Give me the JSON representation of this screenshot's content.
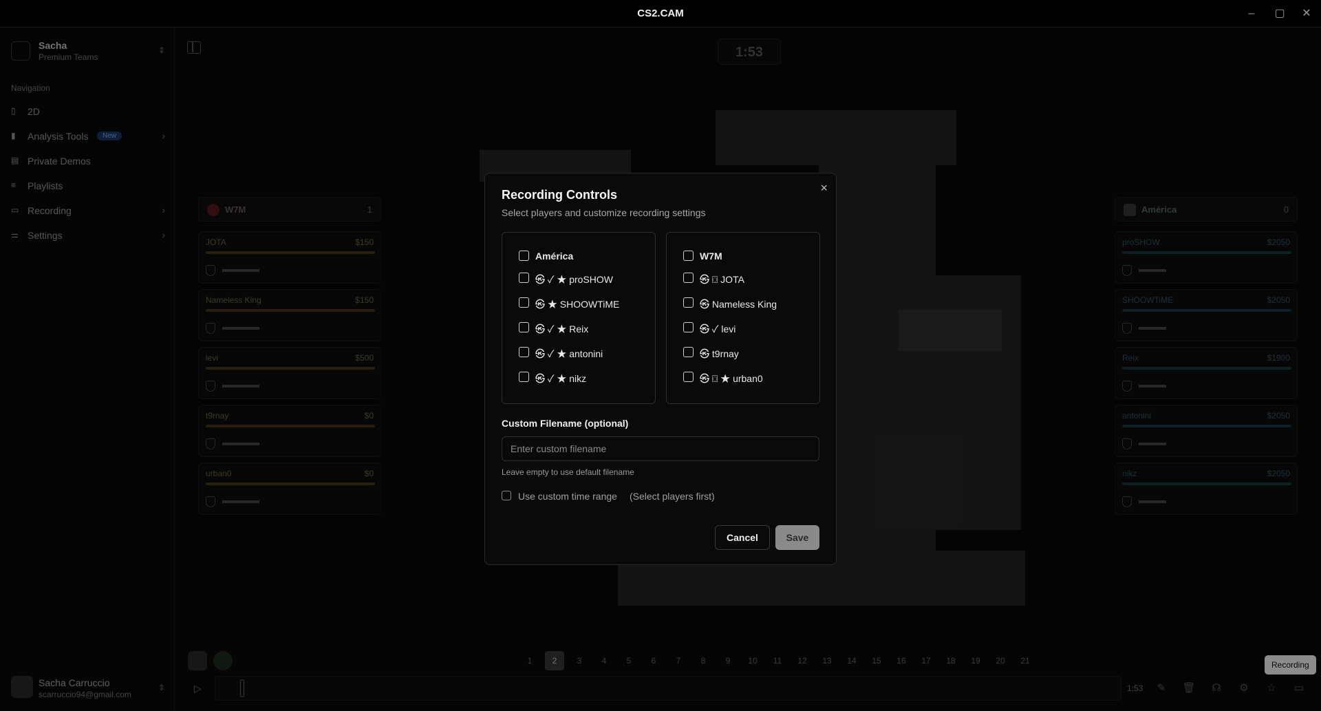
{
  "window": {
    "title": "CS2.CAM",
    "controls": [
      "minimize",
      "maximize",
      "close"
    ]
  },
  "sidebar": {
    "user": {
      "name": "Sacha",
      "plan": "Premium Teams"
    },
    "nav_heading": "Navigation",
    "items": [
      {
        "label": "2D",
        "icon": "map-icon"
      },
      {
        "label": "Analysis Tools",
        "icon": "bar-chart-icon",
        "badge": "New"
      },
      {
        "label": "Private Demos",
        "icon": "file-icon"
      },
      {
        "label": "Playlists",
        "icon": "list-icon"
      },
      {
        "label": "Recording",
        "icon": "video-icon"
      },
      {
        "label": "Settings",
        "icon": "sliders-icon"
      }
    ],
    "account": {
      "name": "Sacha Carruccio",
      "email": "scarruccio94@gmail.com"
    }
  },
  "match": {
    "timer": "1:53",
    "left_team": {
      "name": "W7M",
      "score": "1",
      "players": [
        {
          "name": "JOTA",
          "money": "$150"
        },
        {
          "name": "Nameless King",
          "money": "$150"
        },
        {
          "name": "levi",
          "money": "$500"
        },
        {
          "name": "t9rnay",
          "money": "$0"
        },
        {
          "name": "urban0",
          "money": "$0"
        }
      ]
    },
    "right_team": {
      "name": "América",
      "score": "0",
      "players": [
        {
          "name": "proSHOW",
          "money": "$2050"
        },
        {
          "name": "SHOOWTiME",
          "money": "$2050"
        },
        {
          "name": "Reix",
          "money": "$1900"
        },
        {
          "name": "antonini",
          "money": "$2050"
        },
        {
          "name": "nikz",
          "money": "$2050"
        }
      ]
    },
    "rounds": [
      "1",
      "2",
      "3",
      "4",
      "5",
      "6",
      "7",
      "8",
      "9",
      "10",
      "11",
      "12",
      "13",
      "14",
      "15",
      "16",
      "17",
      "18",
      "19",
      "20",
      "21"
    ],
    "active_round": "2",
    "time_small": "1:53",
    "tooltip": "Recording"
  },
  "modal": {
    "title": "Recording Controls",
    "subtitle": "Select players and customize recording settings",
    "team_a": {
      "header": "América",
      "players": [
        "㉿ ✓ ★ proSHOW",
        "㉿ ★ SHOOWTiME",
        "㉿ ✓ ★ Reix",
        "㉿ ✓ ★ antonini",
        "㉿ ✓ ★ nikz"
      ]
    },
    "team_b": {
      "header": "W7M",
      "players": [
        "㉿ ⌼ JOTA",
        "㉿ Nameless King",
        "㉿ ✓ levi",
        "㉿ t9rnay",
        "㉿ ⌼ ★ urban0"
      ]
    },
    "filename_label": "Custom Filename (optional)",
    "filename_placeholder": "Enter custom filename",
    "filename_hint": "Leave empty to use default filename",
    "time_range_label": "Use custom time range",
    "time_range_note": "(Select players first)",
    "cancel": "Cancel",
    "save": "Save",
    "close_icon": "×"
  }
}
